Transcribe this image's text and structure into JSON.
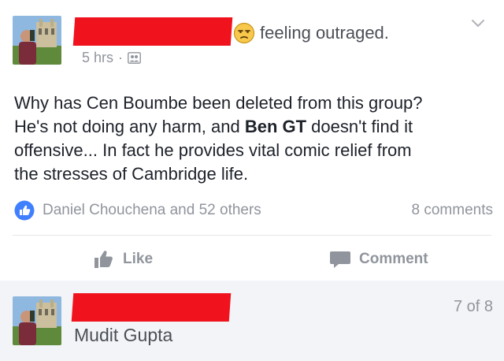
{
  "post": {
    "feeling": "feeling outraged.",
    "timestamp": "5 hrs",
    "separator": "·",
    "body": {
      "line1": "Why has Cen Boumbe been deleted from this group?",
      "line2_start": "He's not doing any harm, and ",
      "line2_bold": "Ben GT",
      "line2_end": " doesn't find it",
      "line3": "offensive... In fact he provides vital comic relief from",
      "line4": "the stresses of Cambridge life."
    },
    "reactions_text": "Daniel Chouchena and 52 others",
    "comments_count": "8 comments",
    "actions": {
      "like": "Like",
      "comment": "Comment"
    }
  },
  "next_item": {
    "name": "Mudit Gupta",
    "counter": "7 of 8"
  },
  "colors": {
    "redaction": "#f0121c",
    "like_blue": "#4080ff",
    "muted_text": "#90949c",
    "emoji_yellow": "#f7c84b"
  },
  "icons": {
    "feeling": "unamused-face-emoji",
    "privacy": "group-privacy-icon",
    "reaction": "thumbs-up-badge",
    "menu": "chevron-down-icon"
  }
}
